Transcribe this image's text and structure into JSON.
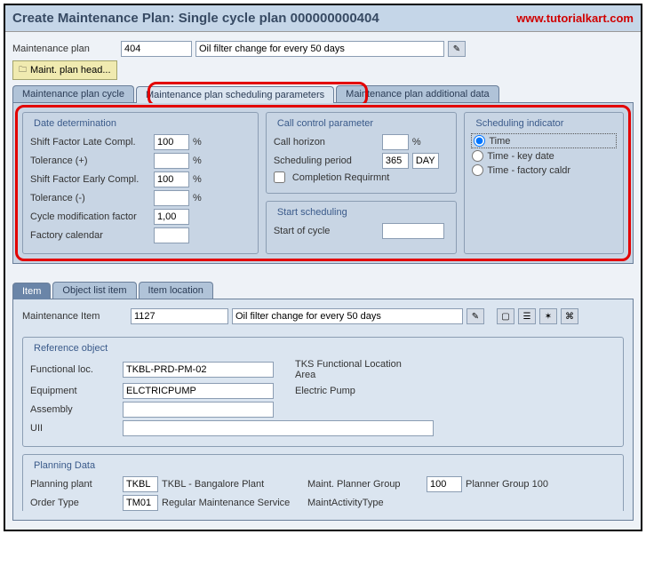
{
  "title": "Create Maintenance Plan: Single cycle plan 000000000404",
  "watermark": "www.tutorialkart.com",
  "plan": {
    "label": "Maintenance plan",
    "number": "404",
    "desc": "Oil filter change for every 50 days",
    "head_btn": "Maint. plan head..."
  },
  "tabs": {
    "cycle": "Maintenance plan cycle",
    "sched": "Maintenance plan scheduling parameters",
    "addl": "Maintenance plan additional data"
  },
  "date_det": {
    "title": "Date determination",
    "shift_late_lbl": "Shift Factor Late Compl.",
    "shift_late_val": "100",
    "tol_plus_lbl": "Tolerance (+)",
    "tol_plus_val": "",
    "shift_early_lbl": "Shift Factor Early Compl.",
    "shift_early_val": "100",
    "tol_minus_lbl": "Tolerance (-)",
    "tol_minus_val": "",
    "cycle_mod_lbl": "Cycle modification factor",
    "cycle_mod_val": "1,00",
    "factory_cal_lbl": "Factory calendar",
    "factory_cal_val": "",
    "pct": "%"
  },
  "call_ctrl": {
    "title": "Call control parameter",
    "horizon_lbl": "Call horizon",
    "horizon_val": "",
    "horizon_unit": "%",
    "period_lbl": "Scheduling period",
    "period_val": "365",
    "period_unit": "DAY",
    "completion_lbl": "Completion Requirmnt"
  },
  "start_sched": {
    "title": "Start scheduling",
    "start_lbl": "Start of cycle",
    "start_val": ""
  },
  "sched_ind": {
    "title": "Scheduling indicator",
    "time": "Time",
    "time_key": "Time - key date",
    "time_fact": "Time - factory caldr"
  },
  "item_tabs": {
    "item": "Item",
    "objlist": "Object list item",
    "itemloc": "Item location"
  },
  "maint_item": {
    "label": "Maintenance Item",
    "number": "1127",
    "desc": "Oil filter change for every 50 days"
  },
  "ref_obj": {
    "title": "Reference object",
    "funcloc_lbl": "Functional loc.",
    "funcloc_val": "TKBL-PRD-PM-02",
    "funcloc_desc": "TKS Functional Location Area",
    "equip_lbl": "Equipment",
    "equip_val": "ELCTRICPUMP",
    "equip_desc": "Electric Pump",
    "assembly_lbl": "Assembly",
    "assembly_val": "",
    "uii_lbl": "UII",
    "uii_val": ""
  },
  "planning": {
    "title": "Planning Data",
    "plant_lbl": "Planning plant",
    "plant_val": "TKBL",
    "plant_desc": "TKBL - Bangalore Plant",
    "planner_grp_lbl": "Maint. Planner Group",
    "planner_grp_val": "100",
    "planner_grp_desc": "Planner Group 100",
    "order_lbl": "Order Type",
    "order_val": "TM01",
    "order_desc": "Regular Maintenance Service",
    "mat_lbl": "MaintActivityType"
  }
}
